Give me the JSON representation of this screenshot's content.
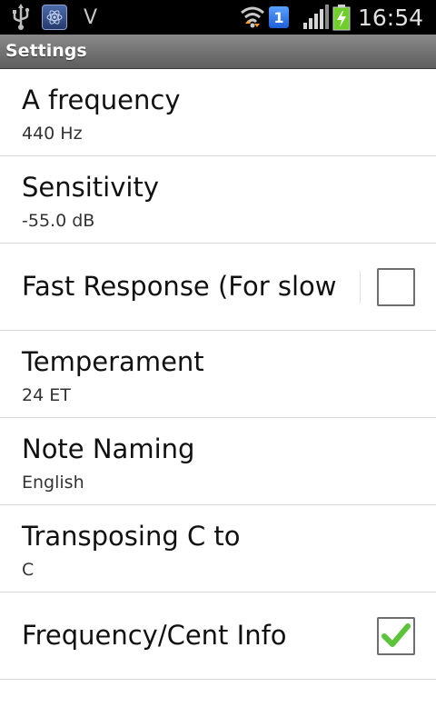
{
  "status_bar": {
    "indicator": "V",
    "notification_count": "1",
    "time": "16:54",
    "icons": [
      "usb-icon",
      "app-icon",
      "wifi-icon",
      "signal-icon",
      "battery-charging-icon"
    ]
  },
  "action_bar": {
    "title": "Settings"
  },
  "settings": [
    {
      "title": "A frequency",
      "summary": "440 Hz"
    },
    {
      "title": "Sensitivity",
      "summary": "-55.0 dB"
    },
    {
      "title": "Fast Response (For slow",
      "checked": false
    },
    {
      "title": "Temperament",
      "summary": "24 ET"
    },
    {
      "title": "Note Naming",
      "summary": "English"
    },
    {
      "title": "Transposing C to",
      "summary": "C"
    },
    {
      "title": "Frequency/Cent Info",
      "checked": true
    }
  ],
  "colors": {
    "check_green": "#5cc43a",
    "status_bar": "#000000",
    "action_bar": "#6f6f6f"
  }
}
